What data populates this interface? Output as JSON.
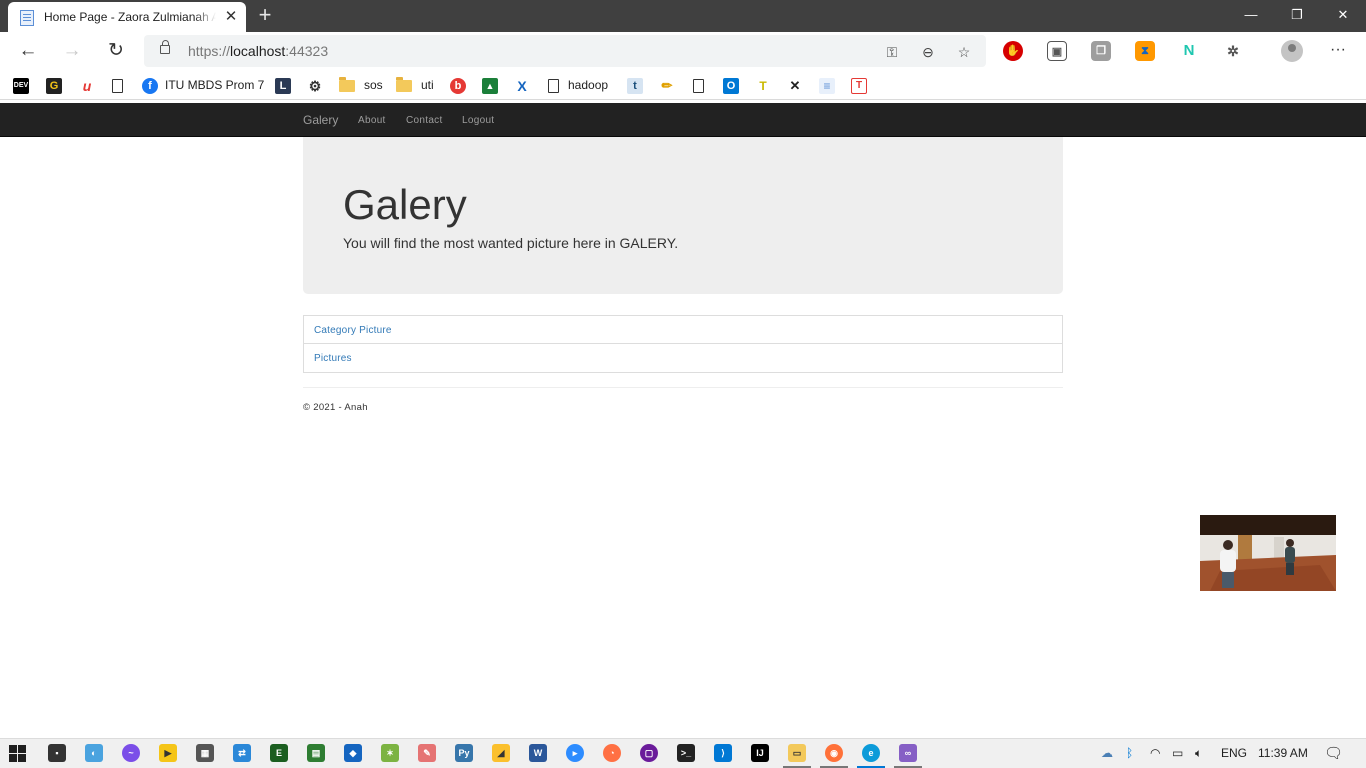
{
  "browser": {
    "tab_title": "Home Page - Zaora Zulmianah A",
    "tab_close": "✕",
    "new_tab": "+",
    "window_minimize": "—",
    "window_restore": "❐",
    "window_close": "✕",
    "back": "←",
    "forward": "→",
    "refresh": "↻",
    "url_protocol": "https://",
    "url_host": "localhost",
    "url_port": ":44323",
    "more": "···"
  },
  "favorites": [
    {
      "label": "",
      "icon": "dev-icon",
      "icon_text": "DEV",
      "bg": "#000000",
      "fg": "#ffffff"
    },
    {
      "label": "",
      "icon": "g-icon",
      "icon_text": "G",
      "bg": "#222222",
      "fg": "#f5c518"
    },
    {
      "label": "",
      "icon": "u-icon",
      "icon_text": "u",
      "bg": "#ffffff",
      "fg": "#e53935"
    },
    {
      "label": "",
      "icon": "page-icon"
    },
    {
      "label": "ITU MBDS Prom 7",
      "icon": "facebook-icon",
      "icon_text": "f",
      "bg": "#1877f2",
      "fg": "#ffffff"
    },
    {
      "label": "",
      "icon": "l-icon",
      "icon_text": "L",
      "bg": "#2b3a55",
      "fg": "#ffffff"
    },
    {
      "label": "",
      "icon": "gear-icon",
      "icon_text": "⚙",
      "bg": "#ffffff",
      "fg": "#333333"
    },
    {
      "label": "sos",
      "icon": "folder-icon"
    },
    {
      "label": "uti",
      "icon": "folder-icon"
    },
    {
      "label": "",
      "icon": "b-icon",
      "icon_text": "b",
      "bg": "#e53935",
      "fg": "#ffffff"
    },
    {
      "label": "",
      "icon": "chart-icon",
      "icon_text": "▲",
      "bg": "#1b7f3a",
      "fg": "#ffffff"
    },
    {
      "label": "",
      "icon": "x-icon",
      "icon_text": "X",
      "bg": "#ffffff",
      "fg": "#1565c0"
    },
    {
      "label": "hadoop",
      "icon": "page-icon"
    },
    {
      "label": "",
      "icon": "t-icon",
      "icon_text": "t",
      "bg": "#d6e4f2",
      "fg": "#1a4e7a"
    },
    {
      "label": "",
      "icon": "pencil-icon",
      "icon_text": "✏",
      "bg": "#ffffff",
      "fg": "#e0a000"
    },
    {
      "label": "",
      "icon": "page-icon"
    },
    {
      "label": "",
      "icon": "outlook-icon",
      "icon_text": "O",
      "bg": "#0078d4",
      "fg": "#ffffff"
    },
    {
      "label": "",
      "icon": "t-yellow-icon",
      "icon_text": "T",
      "bg": "#ffffff",
      "fg": "#c9b800"
    },
    {
      "label": "",
      "icon": "cross-icon",
      "icon_text": "✕",
      "bg": "#ffffff",
      "fg": "#222222"
    },
    {
      "label": "",
      "icon": "doc-icon",
      "icon_text": "≡",
      "bg": "#e8f0fb",
      "fg": "#5c8fd6"
    },
    {
      "label": "",
      "icon": "t-red-icon",
      "icon_text": "T",
      "bg": "#ffffff",
      "fg": "#e53935"
    }
  ],
  "site": {
    "brand": "Galery",
    "nav": [
      "About",
      "Contact",
      "Logout"
    ],
    "jumbotron": {
      "title": "Galery",
      "lead": "You will find the most wanted picture here in GALERY."
    },
    "links": [
      "Category Picture",
      "Pictures"
    ],
    "footer": "© 2021 - Anah"
  },
  "taskbar": {
    "language": "ENG",
    "time": "11:39 AM"
  }
}
